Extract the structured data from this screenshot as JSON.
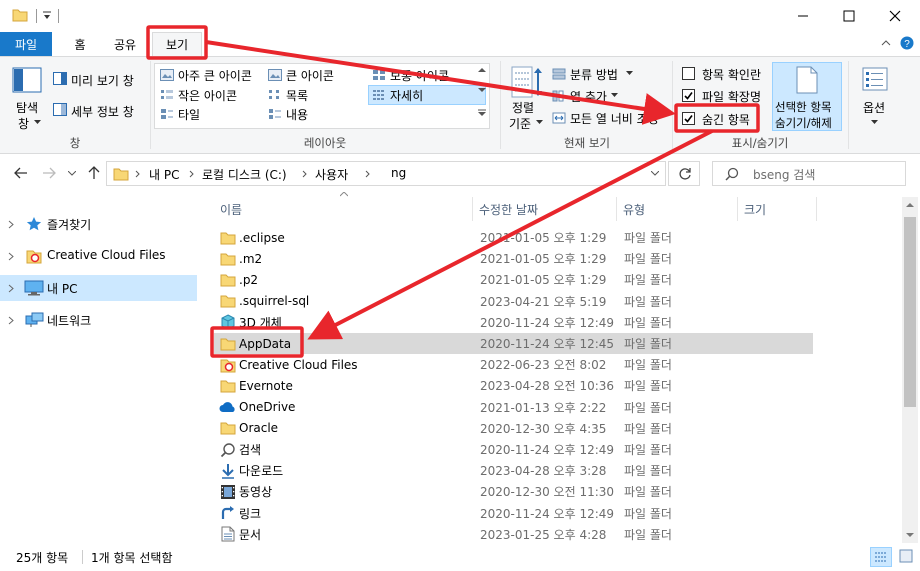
{
  "ribbon_tabs": {
    "file": "파일",
    "home": "홈",
    "share": "공유",
    "view": "보기"
  },
  "ribbon": {
    "pane": {
      "nav_pane_1": "탐색",
      "nav_pane_2": "창",
      "preview": "미리 보기 창",
      "details": "세부 정보 창",
      "group": "창"
    },
    "layout": {
      "extra_large": "아주 큰 아이콘",
      "large": "큰 아이콘",
      "medium": "보통 아이콘",
      "small": "작은 아이콘",
      "list": "목록",
      "details": "자세히",
      "tiles": "타일",
      "content": "내용",
      "group": "레이아웃"
    },
    "current_view": {
      "sort_1": "정렬",
      "sort_2": "기준",
      "group_by": "분류 방법",
      "add_columns": "열 추가",
      "fit_columns": "모든 열 너비 조정",
      "group": "현재 보기"
    },
    "show_hide": {
      "item_checkboxes": "항목 확인란",
      "file_extensions": "파일 확장명",
      "hidden_items": "숨긴 항목",
      "hide_selected_1": "선택한 항목",
      "hide_selected_2": "숨기기/해제",
      "group": "표시/숨기기"
    },
    "options": "옵션"
  },
  "address": {
    "crumbs": [
      "내 PC",
      "로컬 디스크 (C:)",
      "사용자",
      "ng"
    ],
    "search_placeholder": "bseng 검색"
  },
  "nav": [
    {
      "label": "즐겨찾기",
      "icon": "star-icon"
    },
    {
      "label": "Creative Cloud Files",
      "icon": "creative-cloud-icon"
    },
    {
      "label": "내 PC",
      "icon": "pc-icon"
    },
    {
      "label": "네트워크",
      "icon": "network-icon"
    }
  ],
  "columns": {
    "name": "이름",
    "date": "수정한 날짜",
    "type": "유형",
    "size": "크기"
  },
  "files": [
    {
      "name": ".eclipse",
      "date": "2021-01-05 오후 1:29",
      "type": "파일 폴더",
      "icon": "folder-icon"
    },
    {
      "name": ".m2",
      "date": "2021-01-05 오후 1:29",
      "type": "파일 폴더",
      "icon": "folder-icon"
    },
    {
      "name": ".p2",
      "date": "2021-01-05 오후 1:29",
      "type": "파일 폴더",
      "icon": "folder-icon"
    },
    {
      "name": ".squirrel-sql",
      "date": "2023-04-21 오후 5:19",
      "type": "파일 폴더",
      "icon": "folder-icon"
    },
    {
      "name": "3D 개체",
      "date": "2020-11-24 오후 12:49",
      "type": "파일 폴더",
      "icon": "3d-objects-icon"
    },
    {
      "name": "AppData",
      "date": "2020-11-24 오후 12:45",
      "type": "파일 폴더",
      "icon": "folder-icon"
    },
    {
      "name": "Creative Cloud Files",
      "date": "2022-06-23 오전 8:02",
      "type": "파일 폴더",
      "icon": "creative-cloud-icon"
    },
    {
      "name": "Evernote",
      "date": "2023-04-28 오전 10:36",
      "type": "파일 폴더",
      "icon": "folder-icon"
    },
    {
      "name": "OneDrive",
      "date": "2021-01-13 오후 2:22",
      "type": "파일 폴더",
      "icon": "onedrive-icon"
    },
    {
      "name": "Oracle",
      "date": "2020-12-30 오후 4:35",
      "type": "파일 폴더",
      "icon": "folder-icon"
    },
    {
      "name": "검색",
      "date": "2020-11-24 오후 12:49",
      "type": "파일 폴더",
      "icon": "search-icon"
    },
    {
      "name": "다운로드",
      "date": "2023-04-28 오후 3:28",
      "type": "파일 폴더",
      "icon": "download-icon"
    },
    {
      "name": "동영상",
      "date": "2020-12-30 오전 11:30",
      "type": "파일 폴더",
      "icon": "video-icon"
    },
    {
      "name": "링크",
      "date": "2020-11-24 오후 12:49",
      "type": "파일 폴더",
      "icon": "link-icon"
    },
    {
      "name": "문서",
      "date": "2023-01-25 오후 4:28",
      "type": "파일 폴더",
      "icon": "documents-icon"
    }
  ],
  "status": {
    "count": "25개 항목",
    "selected": "1개 항목 선택함"
  },
  "colors": {
    "accent": "#1979ca",
    "highlight_red": "#e8262c",
    "folder": "#f8d775",
    "selection": "#d9d9d9",
    "nav_selection": "#cce8ff"
  }
}
